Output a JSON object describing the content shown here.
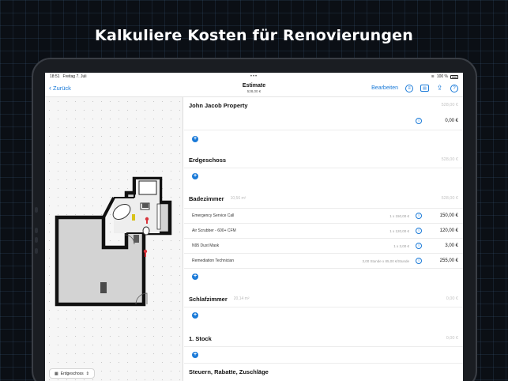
{
  "headline": "Kalkuliere Kosten für Renovierungen",
  "status": {
    "time": "18:51",
    "date": "Freitag 7. Juli",
    "battery": "100 %"
  },
  "nav": {
    "back_label": "Zurück",
    "title": "Estimate",
    "subtitle": "528,00 €",
    "edit_label": "Bearbeiten"
  },
  "floor_selector": {
    "label": "Erdgeschoss"
  },
  "sections": {
    "property": {
      "name": "John Jacob Property",
      "amount": "528,00 €",
      "row_price": "0,00 €"
    },
    "ground": {
      "name": "Erdgeschoss",
      "amount": "528,00 €"
    },
    "bath": {
      "name": "Badezimmer",
      "area": "10,56 m²",
      "amount": "528,00 €",
      "items": [
        {
          "name": "Emergency Service Call",
          "qty": "1 x 150,00 €",
          "price": "150,00 €"
        },
        {
          "name": "Air Scrubber - 600+ CFM",
          "qty": "1 x 120,00 €",
          "price": "120,00 €"
        },
        {
          "name": "N95 Dust Mask",
          "qty": "1 x 3,00 €",
          "price": "3,00 €"
        },
        {
          "name": "Remediation Technician",
          "qty": "3,00 Stunde x 85,00 €/Stunde",
          "price": "255,00 €"
        }
      ]
    },
    "bedroom": {
      "name": "Schlafzimmer",
      "area": "20,14 m²",
      "amount": "0,00 €"
    },
    "first": {
      "name": "1. Stock",
      "amount": "0,00 €"
    },
    "taxes": {
      "name": "Steuern, Rabatte, Zuschläge"
    }
  },
  "colors": {
    "accent": "#1a7ad8",
    "wall": "#111111",
    "floor": "#d2d2d2"
  }
}
